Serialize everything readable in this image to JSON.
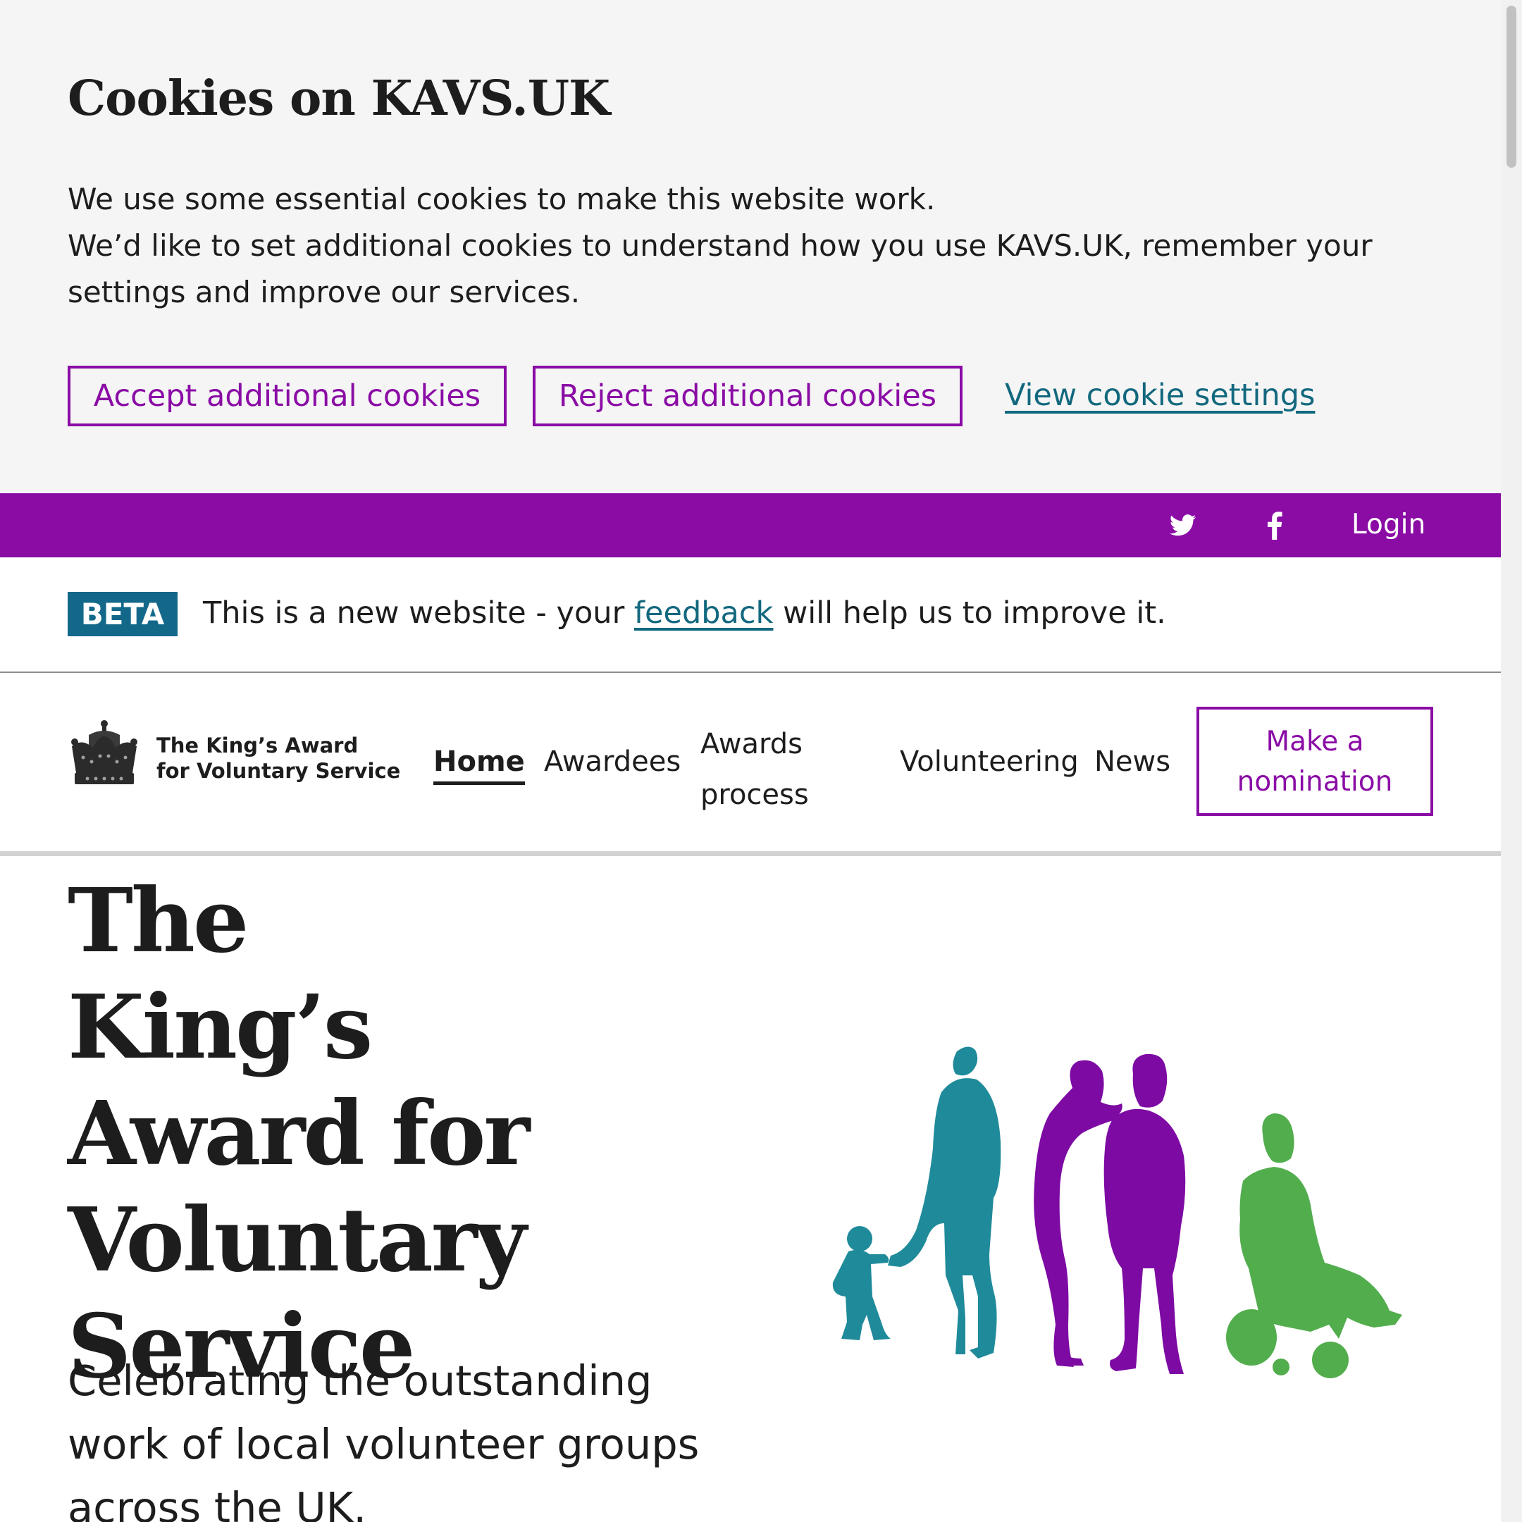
{
  "cookie_banner": {
    "title": "Cookies on KAVS.UK",
    "paragraph_1": "We use some essential cookies to make this website work.",
    "paragraph_2": "We’d like to set additional cookies to understand how you use KAVS.UK, remember your settings and improve our services.",
    "accept_label": "Accept additional cookies",
    "reject_label": "Reject additional cookies",
    "settings_label": "View cookie settings"
  },
  "utility_bar": {
    "icons": [
      "twitter-icon",
      "facebook-icon"
    ],
    "login_label": "Login"
  },
  "beta_banner": {
    "tag": "BETA",
    "text_before": "This is a new website - your ",
    "link": "feedback",
    "text_after": " will help us to improve it."
  },
  "header": {
    "logo": {
      "icon": "crown-icon",
      "line_1": "The King’s Award",
      "line_2": "for Voluntary Service"
    },
    "nav": {
      "home": "Home",
      "awardees": "Awardees",
      "awards_process": "Awards process",
      "volunteering": "Volunteering",
      "news": "News"
    },
    "cta_label": "Make a nomination"
  },
  "hero": {
    "title": "The King’s Award for Voluntary Service",
    "subtitle": "Celebrating the outstanding work of local volunteer groups across the UK.",
    "illustration": "people-silhouettes"
  },
  "colors": {
    "brand_purple": "#8a0ca5",
    "link_teal": "#12687e",
    "beta_tag": "#13688a",
    "figure_teal": "#1f8a9a",
    "figure_purple": "#7d0aa3",
    "figure_green": "#52ad4d"
  }
}
